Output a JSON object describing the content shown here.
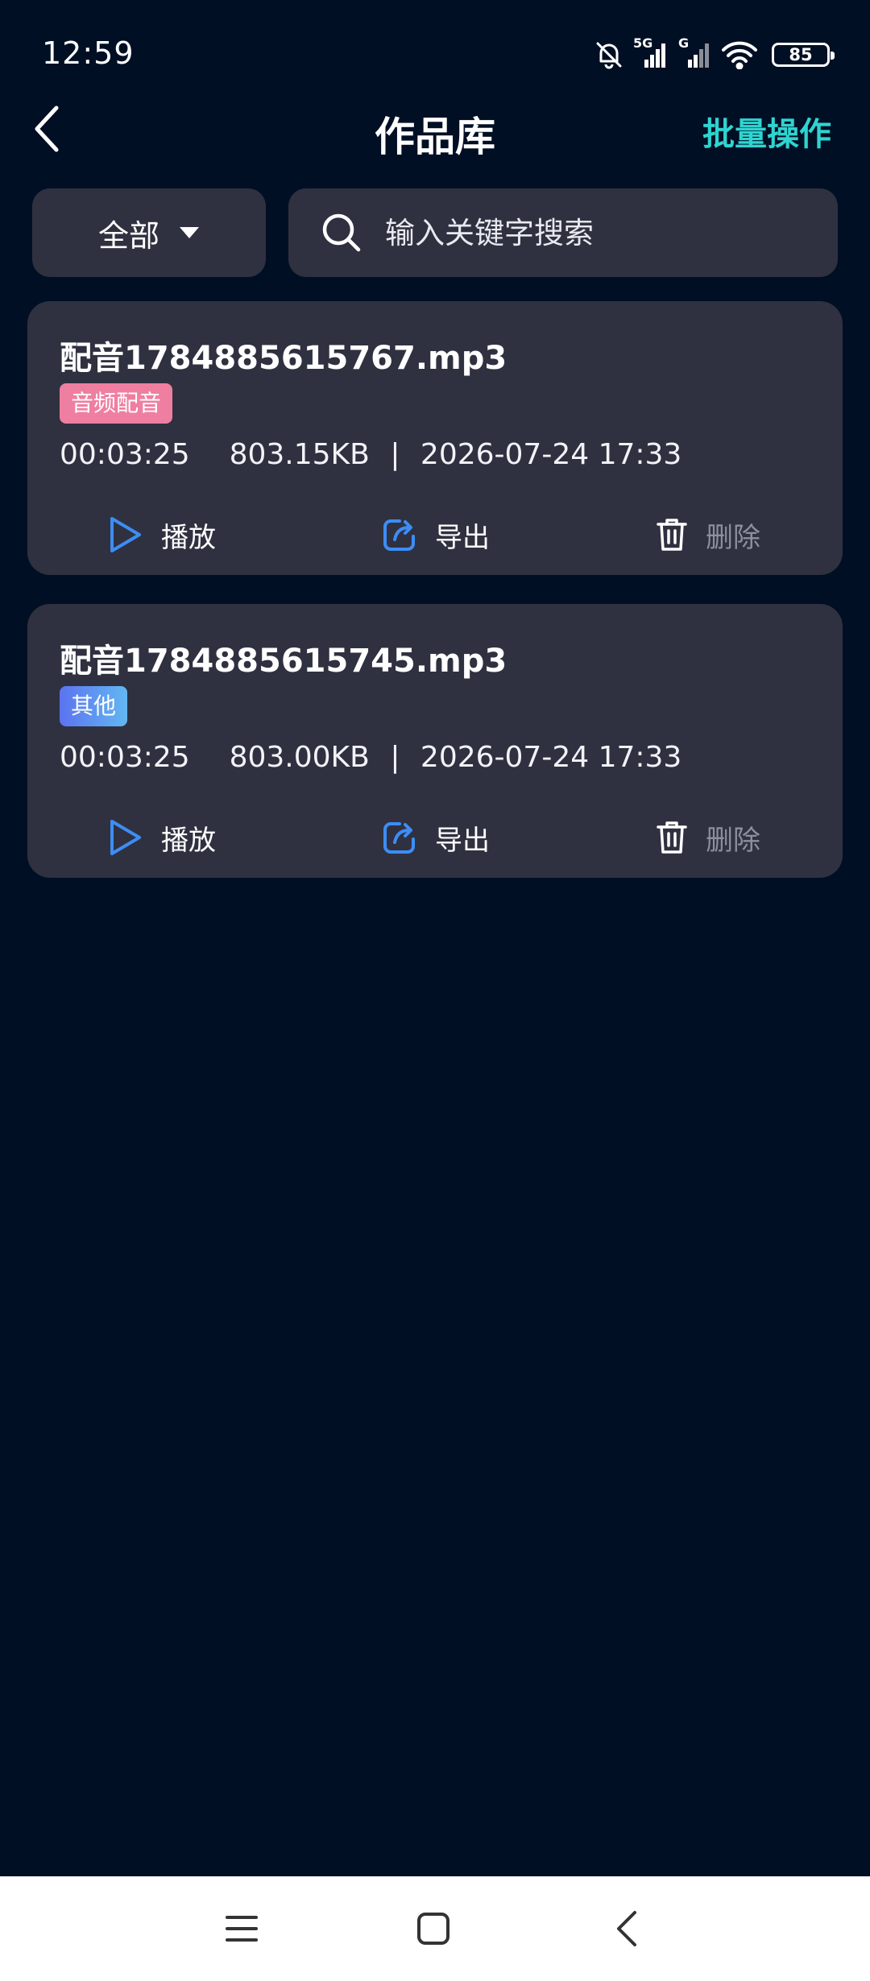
{
  "status_bar": {
    "time": "12:59",
    "network_1": "5G",
    "network_2": "G",
    "battery": "85"
  },
  "header": {
    "title": "作品库",
    "batch_label": "批量操作"
  },
  "filter": {
    "selected": "全部",
    "search_placeholder": "输入关键字搜索"
  },
  "works": [
    {
      "title": "配音1784885615767.mp3",
      "tag": "音频配音",
      "duration": "00:03:25",
      "size": "803.15KB",
      "separator": "|",
      "date": "2026-07-24 17:33",
      "play_label": "播放",
      "export_label": "导出",
      "delete_label": "删除"
    },
    {
      "title": "配音1784885615745.mp3",
      "tag": "其他",
      "duration": "00:03:25",
      "size": "803.00KB",
      "separator": "|",
      "date": "2026-07-24 17:33",
      "play_label": "播放",
      "export_label": "导出",
      "delete_label": "删除"
    }
  ],
  "colors": {
    "background": "#010f24",
    "card": "#2f3140",
    "accent_cyan": "#2fd4d0",
    "icon_blue": "#3d8df5",
    "tag_pink": "#ef7fa0",
    "tag_blue": "#5c73f0",
    "muted": "#8c8f9c"
  },
  "icons": {
    "back": "chevron-left-icon",
    "dropdown": "caret-down-icon",
    "search": "search-icon",
    "play": "play-icon",
    "export": "export-icon",
    "delete": "trash-icon",
    "nav_menu": "menu-icon",
    "nav_home": "home-square-icon",
    "nav_back": "back-chevron-icon"
  }
}
